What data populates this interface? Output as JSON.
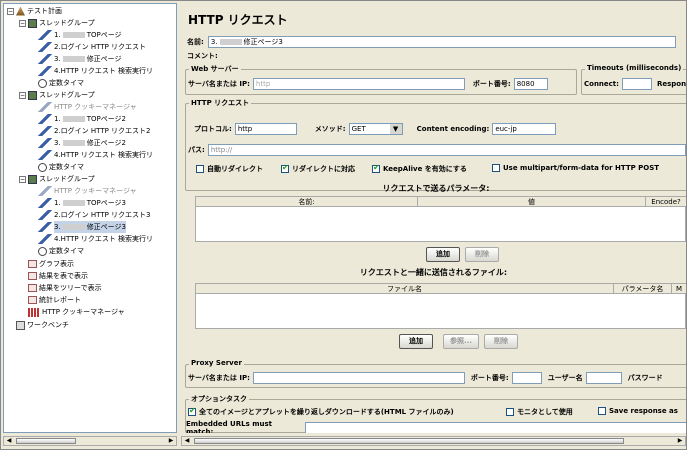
{
  "tree": {
    "root": "テスト計画",
    "groups": [
      "スレッドグループ",
      "スレッドグループ",
      "スレッドグループ"
    ],
    "g1": [
      {
        "pre": "1.",
        "post": "TOPページ"
      },
      {
        "pre": "2.ログイン HTTP リクエスト",
        "post": ""
      },
      {
        "pre": "3.",
        "post": "修正ページ"
      },
      {
        "pre": "4.HTTP リクエスト 検索実行リ",
        "post": ""
      },
      {
        "pre": "定数タイマ",
        "post": ""
      }
    ],
    "g2": [
      {
        "pre": "HTTP クッキーマネージャ",
        "post": ""
      },
      {
        "pre": "1.",
        "post": "TOPページ2"
      },
      {
        "pre": "2.ログイン HTTP リクエスト2",
        "post": ""
      },
      {
        "pre": "3.",
        "post": "修正ページ2"
      },
      {
        "pre": "4.HTTP リクエスト 検索実行リ",
        "post": ""
      },
      {
        "pre": "定数タイマ",
        "post": ""
      }
    ],
    "g3": [
      {
        "pre": "HTTP クッキーマネージャ",
        "post": ""
      },
      {
        "pre": "1.",
        "post": "TOPページ3"
      },
      {
        "pre": "2.ログイン HTTP リクエスト3",
        "post": ""
      },
      {
        "pre": "3.",
        "post": "修正ページ3"
      },
      {
        "pre": "4.HTTP リクエスト 検索実行リ",
        "post": ""
      },
      {
        "pre": "定数タイマ",
        "post": ""
      }
    ],
    "tail": [
      "グラフ表示",
      "結果を表で表示",
      "結果をツリーで表示",
      "統計レポート",
      "HTTP クッキーマネージャ"
    ],
    "workbench": "ワークベンチ"
  },
  "panel": {
    "title": "HTTP リクエスト",
    "name_label": "名前:",
    "name_value": "3.",
    "name_suffix": "修正ページ3",
    "comment_label": "コメント:",
    "webserver_legend": "Web サーバー",
    "server_label": "サーバ名または IP:",
    "server_value": "http",
    "port_label": "ポート番号:",
    "port_value": "8080",
    "timeouts_legend": "Timeouts (milliseconds)",
    "connect_label": "Connect:",
    "response_label": "Respon",
    "httpreq_legend": "HTTP リクエスト",
    "protocol_label": "プロトコル:",
    "protocol_value": "http",
    "method_label": "メソッド:",
    "method_value": "GET",
    "encoding_label": "Content encoding:",
    "encoding_value": "euc-jp",
    "path_label": "パス:",
    "path_value": "http://",
    "cb_redirect": "自動リダイレクト",
    "cb_follow": "リダイレクトに対応",
    "cb_keepalive": "KeepAlive を有効にする",
    "cb_multipart": "Use multipart/form-data for HTTP POST",
    "params_title": "リクエストで送るパラメータ:",
    "params_cols": [
      "名前:",
      "値",
      "Encode?"
    ],
    "add_btn": "追加",
    "del_btn": "削除",
    "files_title": "リクエストと一緒に送信されるファイル:",
    "files_cols": [
      "ファイル名",
      "パラメータ名",
      "M"
    ],
    "add_btn2": "追加",
    "browse_btn": "参照...",
    "del_btn2": "削除",
    "proxy_legend": "Proxy Server",
    "proxy_server_label": "サーバ名または IP:",
    "proxy_port_label": "ポート番号:",
    "proxy_user_label": "ユーザー名",
    "proxy_pass_label": "パスワード",
    "opt_legend": "オプションタスク",
    "cb_images": "全てのイメージとアプレットを繰り返しダウンロードする(HTML ファイルのみ)",
    "cb_monitor": "モニタとして使用",
    "cb_save": "Save response as",
    "embedded_label": "Embedded URLs must match:"
  }
}
